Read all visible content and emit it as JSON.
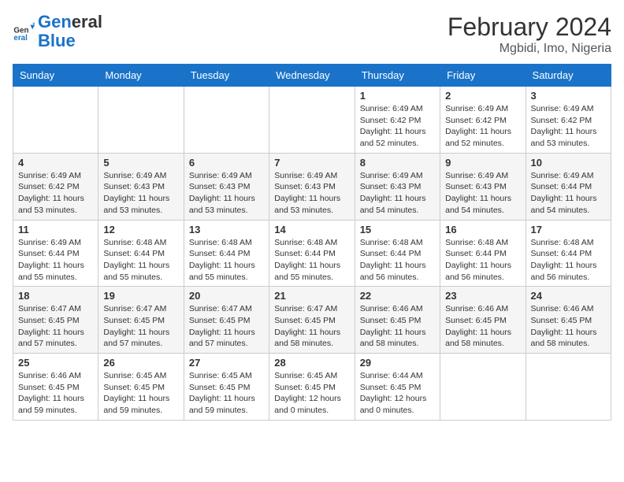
{
  "logo": {
    "name1": "General",
    "name2": "Blue"
  },
  "title": "February 2024",
  "location": "Mgbidi, Imo, Nigeria",
  "days_header": [
    "Sunday",
    "Monday",
    "Tuesday",
    "Wednesday",
    "Thursday",
    "Friday",
    "Saturday"
  ],
  "weeks": [
    [
      {
        "day": "",
        "info": ""
      },
      {
        "day": "",
        "info": ""
      },
      {
        "day": "",
        "info": ""
      },
      {
        "day": "",
        "info": ""
      },
      {
        "day": "1",
        "sunrise": "Sunrise: 6:49 AM",
        "sunset": "Sunset: 6:42 PM",
        "daylight": "Daylight: 11 hours and 52 minutes."
      },
      {
        "day": "2",
        "sunrise": "Sunrise: 6:49 AM",
        "sunset": "Sunset: 6:42 PM",
        "daylight": "Daylight: 11 hours and 52 minutes."
      },
      {
        "day": "3",
        "sunrise": "Sunrise: 6:49 AM",
        "sunset": "Sunset: 6:42 PM",
        "daylight": "Daylight: 11 hours and 53 minutes."
      }
    ],
    [
      {
        "day": "4",
        "sunrise": "Sunrise: 6:49 AM",
        "sunset": "Sunset: 6:42 PM",
        "daylight": "Daylight: 11 hours and 53 minutes."
      },
      {
        "day": "5",
        "sunrise": "Sunrise: 6:49 AM",
        "sunset": "Sunset: 6:43 PM",
        "daylight": "Daylight: 11 hours and 53 minutes."
      },
      {
        "day": "6",
        "sunrise": "Sunrise: 6:49 AM",
        "sunset": "Sunset: 6:43 PM",
        "daylight": "Daylight: 11 hours and 53 minutes."
      },
      {
        "day": "7",
        "sunrise": "Sunrise: 6:49 AM",
        "sunset": "Sunset: 6:43 PM",
        "daylight": "Daylight: 11 hours and 53 minutes."
      },
      {
        "day": "8",
        "sunrise": "Sunrise: 6:49 AM",
        "sunset": "Sunset: 6:43 PM",
        "daylight": "Daylight: 11 hours and 54 minutes."
      },
      {
        "day": "9",
        "sunrise": "Sunrise: 6:49 AM",
        "sunset": "Sunset: 6:43 PM",
        "daylight": "Daylight: 11 hours and 54 minutes."
      },
      {
        "day": "10",
        "sunrise": "Sunrise: 6:49 AM",
        "sunset": "Sunset: 6:44 PM",
        "daylight": "Daylight: 11 hours and 54 minutes."
      }
    ],
    [
      {
        "day": "11",
        "sunrise": "Sunrise: 6:49 AM",
        "sunset": "Sunset: 6:44 PM",
        "daylight": "Daylight: 11 hours and 55 minutes."
      },
      {
        "day": "12",
        "sunrise": "Sunrise: 6:48 AM",
        "sunset": "Sunset: 6:44 PM",
        "daylight": "Daylight: 11 hours and 55 minutes."
      },
      {
        "day": "13",
        "sunrise": "Sunrise: 6:48 AM",
        "sunset": "Sunset: 6:44 PM",
        "daylight": "Daylight: 11 hours and 55 minutes."
      },
      {
        "day": "14",
        "sunrise": "Sunrise: 6:48 AM",
        "sunset": "Sunset: 6:44 PM",
        "daylight": "Daylight: 11 hours and 55 minutes."
      },
      {
        "day": "15",
        "sunrise": "Sunrise: 6:48 AM",
        "sunset": "Sunset: 6:44 PM",
        "daylight": "Daylight: 11 hours and 56 minutes."
      },
      {
        "day": "16",
        "sunrise": "Sunrise: 6:48 AM",
        "sunset": "Sunset: 6:44 PM",
        "daylight": "Daylight: 11 hours and 56 minutes."
      },
      {
        "day": "17",
        "sunrise": "Sunrise: 6:48 AM",
        "sunset": "Sunset: 6:44 PM",
        "daylight": "Daylight: 11 hours and 56 minutes."
      }
    ],
    [
      {
        "day": "18",
        "sunrise": "Sunrise: 6:47 AM",
        "sunset": "Sunset: 6:45 PM",
        "daylight": "Daylight: 11 hours and 57 minutes."
      },
      {
        "day": "19",
        "sunrise": "Sunrise: 6:47 AM",
        "sunset": "Sunset: 6:45 PM",
        "daylight": "Daylight: 11 hours and 57 minutes."
      },
      {
        "day": "20",
        "sunrise": "Sunrise: 6:47 AM",
        "sunset": "Sunset: 6:45 PM",
        "daylight": "Daylight: 11 hours and 57 minutes."
      },
      {
        "day": "21",
        "sunrise": "Sunrise: 6:47 AM",
        "sunset": "Sunset: 6:45 PM",
        "daylight": "Daylight: 11 hours and 58 minutes."
      },
      {
        "day": "22",
        "sunrise": "Sunrise: 6:46 AM",
        "sunset": "Sunset: 6:45 PM",
        "daylight": "Daylight: 11 hours and 58 minutes."
      },
      {
        "day": "23",
        "sunrise": "Sunrise: 6:46 AM",
        "sunset": "Sunset: 6:45 PM",
        "daylight": "Daylight: 11 hours and 58 minutes."
      },
      {
        "day": "24",
        "sunrise": "Sunrise: 6:46 AM",
        "sunset": "Sunset: 6:45 PM",
        "daylight": "Daylight: 11 hours and 58 minutes."
      }
    ],
    [
      {
        "day": "25",
        "sunrise": "Sunrise: 6:46 AM",
        "sunset": "Sunset: 6:45 PM",
        "daylight": "Daylight: 11 hours and 59 minutes."
      },
      {
        "day": "26",
        "sunrise": "Sunrise: 6:45 AM",
        "sunset": "Sunset: 6:45 PM",
        "daylight": "Daylight: 11 hours and 59 minutes."
      },
      {
        "day": "27",
        "sunrise": "Sunrise: 6:45 AM",
        "sunset": "Sunset: 6:45 PM",
        "daylight": "Daylight: 11 hours and 59 minutes."
      },
      {
        "day": "28",
        "sunrise": "Sunrise: 6:45 AM",
        "sunset": "Sunset: 6:45 PM",
        "daylight": "Daylight: 12 hours and 0 minutes."
      },
      {
        "day": "29",
        "sunrise": "Sunrise: 6:44 AM",
        "sunset": "Sunset: 6:45 PM",
        "daylight": "Daylight: 12 hours and 0 minutes."
      },
      {
        "day": "",
        "info": ""
      },
      {
        "day": "",
        "info": ""
      }
    ]
  ]
}
